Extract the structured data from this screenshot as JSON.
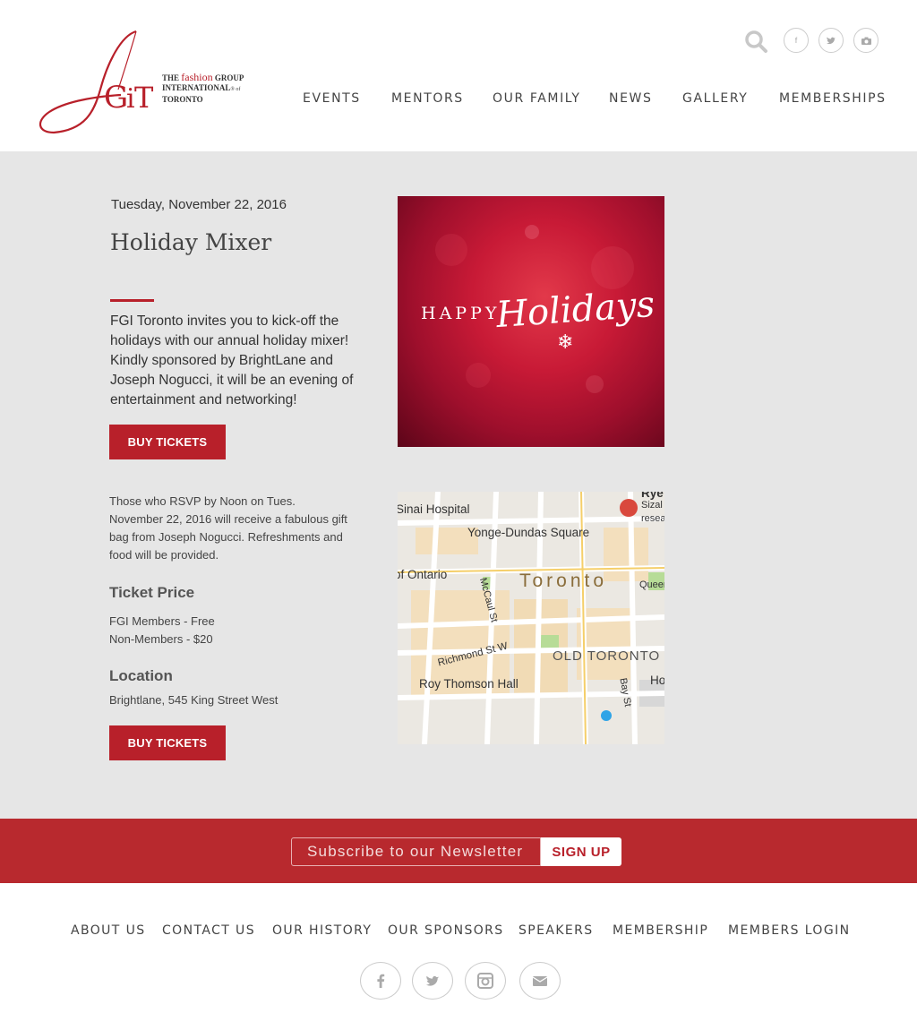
{
  "header": {
    "logo": {
      "text_line1_prefix": "THE",
      "text_line1_accent": "fashion",
      "text_line1_suffix": "GROUP",
      "text_line2": "INTERNATIONAL",
      "text_line2_sup": "® of",
      "text_line3": "TORONTO",
      "monogram": "fGiT"
    },
    "search_icon": "search-icon",
    "social": [
      {
        "icon": "facebook-icon",
        "glyph": "f"
      },
      {
        "icon": "twitter-icon",
        "glyph": "🐦"
      },
      {
        "icon": "camera-icon",
        "glyph": "◙"
      }
    ],
    "nav": [
      "EVENTS",
      "MENTORS",
      "OUR FAMILY",
      "NEWS",
      "GALLERY",
      "MEMBERSHIPS"
    ]
  },
  "event": {
    "date": "Tuesday, November 22, 2016",
    "title": "Holiday Mixer",
    "description": "FGI Toronto invites you to kick-off the holidays with our annual holiday mixer! Kindly sponsored by BrightLane and Joseph Nogucci, it will be an evening of entertainment and networking!",
    "buy_label": "BUY TICKETS",
    "rsvp": "Those who RSVP by Noon on Tues. November 22, 2016 will receive a fabulous gift bag from Joseph Nogucci. Refreshments and food will be provided.",
    "ticket_heading": "Ticket Price",
    "ticket_members": "FGI Members - Free",
    "ticket_nonmembers": "Non-Members - $20",
    "location_heading": "Location",
    "location": "Brightlane, 545 King Street West",
    "image": {
      "happy": "HAPPY",
      "holidays": "Holidays",
      "flake": "❄"
    }
  },
  "map": {
    "labels": {
      "sinai": "Sinai Hospital",
      "yonge": "Yonge-Dundas Square",
      "ontario": "of Ontario",
      "toronto": "Toronto",
      "mccaul": "McCaul St",
      "queen": "Queen",
      "richmond": "Richmond St W",
      "old_toronto": "OLD TORONTO",
      "roy": "Roy Thomson Hall",
      "bay": "Bay St",
      "ho": "Ho",
      "rye": "Rye",
      "sizal": "Sizal",
      "resea": "resea"
    }
  },
  "newsletter": {
    "placeholder": "Subscribe to our Newsletter",
    "button": "SIGN UP"
  },
  "footer": {
    "links": [
      "ABOUT US",
      "CONTACT US",
      "OUR HISTORY",
      "OUR SPONSORS",
      "SPEAKERS",
      "MEMBERSHIP",
      "MEMBERS LOGIN"
    ],
    "social": [
      "facebook-icon",
      "twitter-icon",
      "instagram-icon",
      "email-icon"
    ]
  },
  "colors": {
    "brand_red": "#b8202a",
    "bar_red": "#b8292e",
    "body_bg": "#e6e6e6"
  }
}
